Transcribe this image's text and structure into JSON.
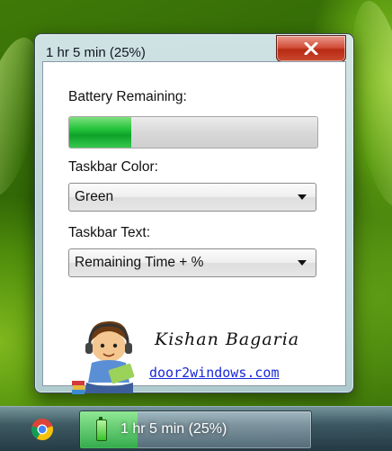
{
  "window": {
    "title": "1 hr 5 min (25%)",
    "close_icon": "close-icon"
  },
  "battery": {
    "label": "Battery Remaining:",
    "level_percent": 25,
    "fill_color": "#1cbf36"
  },
  "taskbar_color": {
    "label": "Taskbar Color:",
    "selected": "Green"
  },
  "taskbar_text": {
    "label": "Taskbar Text:",
    "selected": "Remaining Time + %"
  },
  "credits": {
    "author": "Kishan Bagaria",
    "website": "door2windows.com"
  },
  "taskbar": {
    "pinned_icon": "chrome-icon",
    "active_item_icon": "battery-icon",
    "active_item_text": "1 hr 5 min (25%)",
    "active_item_level_percent": 25
  }
}
